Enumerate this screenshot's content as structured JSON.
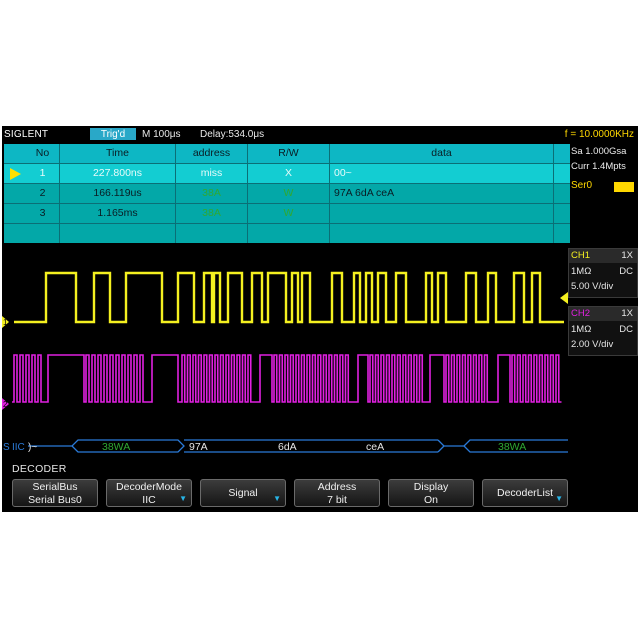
{
  "status_bar": {
    "brand": "SIGLENT",
    "trigger_state": "Trig'd",
    "timebase": "M 100μs",
    "delay": "Delay:534.0μs",
    "frequency": "f = 10.0000KHz"
  },
  "decode_table": {
    "headers": [
      "No",
      "Time",
      "address",
      "R/W",
      "data"
    ],
    "rows": [
      {
        "no": "1",
        "time": "227.800ns",
        "address": "miss",
        "rw": "X",
        "data": "00~"
      },
      {
        "no": "2",
        "time": "166.119us",
        "address": "38A",
        "rw": "W",
        "data": "97A  6dA  ceA"
      },
      {
        "no": "3",
        "time": "1.165ms",
        "address": "38A",
        "rw": "W",
        "data": ""
      }
    ]
  },
  "acquisition": {
    "sample_rate": "Sa 1.000Gsa",
    "memory_depth": "Curr 1.4Mpts",
    "serial_label": "Ser0"
  },
  "channels": [
    {
      "name": "CH1",
      "probe": "1X",
      "impedance": "1MΩ",
      "coupling": "DC",
      "scale": "5.00 V/div",
      "color": "#f4f020"
    },
    {
      "name": "CH2",
      "probe": "1X",
      "impedance": "1MΩ",
      "coupling": "DC",
      "scale": "2.00 V/div",
      "color": "#e020e0"
    }
  ],
  "waveform_markers": {
    "ch1_marker": "1",
    "ch2_marker": "2",
    "bus_marker": "S",
    "bus_label": "IIC"
  },
  "bus_decode": {
    "tokens": [
      "38WA",
      "97A",
      "6dA",
      "ceA",
      "38WA"
    ],
    "start_symbol": ")~"
  },
  "decoder_label": "DECODER",
  "menu": [
    {
      "line1": "SerialBus",
      "line2": "Serial Bus0",
      "knob": false
    },
    {
      "line1": "DecoderMode",
      "line2": "IIC",
      "knob": true
    },
    {
      "line1": "Signal",
      "line2": "",
      "knob": true
    },
    {
      "line1": "Address",
      "line2": "7 bit",
      "knob": false
    },
    {
      "line1": "Display",
      "line2": "On",
      "knob": false
    },
    {
      "line1": "DecoderList",
      "line2": "",
      "knob": true
    }
  ],
  "colors": {
    "ch1": "#f4f020",
    "ch2": "#e020e0",
    "bus": "#2a7ad8",
    "decode_green": "#2fa832",
    "table_bg": "#03a8a8",
    "trigger_badge": "#29a8c8"
  }
}
